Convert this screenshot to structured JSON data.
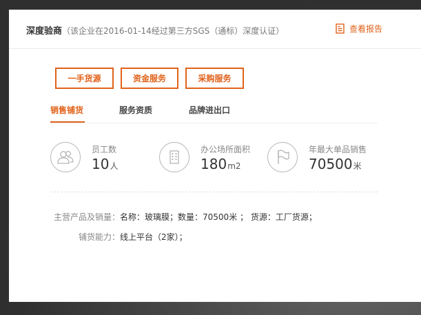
{
  "header": {
    "title_strong": "深度验商",
    "title_note": "（该企业在2016-01-14经过第三方SGS（通标）深度认证）",
    "report_label": "查看报告"
  },
  "tags": [
    "一手货源",
    "资金服务",
    "采购服务"
  ],
  "tabs": [
    "销售铺货",
    "服务资质",
    "品牌进出口"
  ],
  "stats": [
    {
      "label": "员工数",
      "value": "10",
      "unit": "人"
    },
    {
      "label": "办公场所面积",
      "value": "180",
      "unit": "m2"
    },
    {
      "label": "年最大单品销售",
      "value": "70500",
      "unit": "米"
    }
  ],
  "info": {
    "products_key": "主营产品及销量：",
    "products_value": "名称：玻璃膜；数量：70500米 ； 货源：工厂货源；",
    "channel_key": "铺货能力：",
    "channel_value": "线上平台（2家）；"
  },
  "colors": {
    "accent": "#e0621a",
    "icon_gray": "#b5b5b5"
  }
}
